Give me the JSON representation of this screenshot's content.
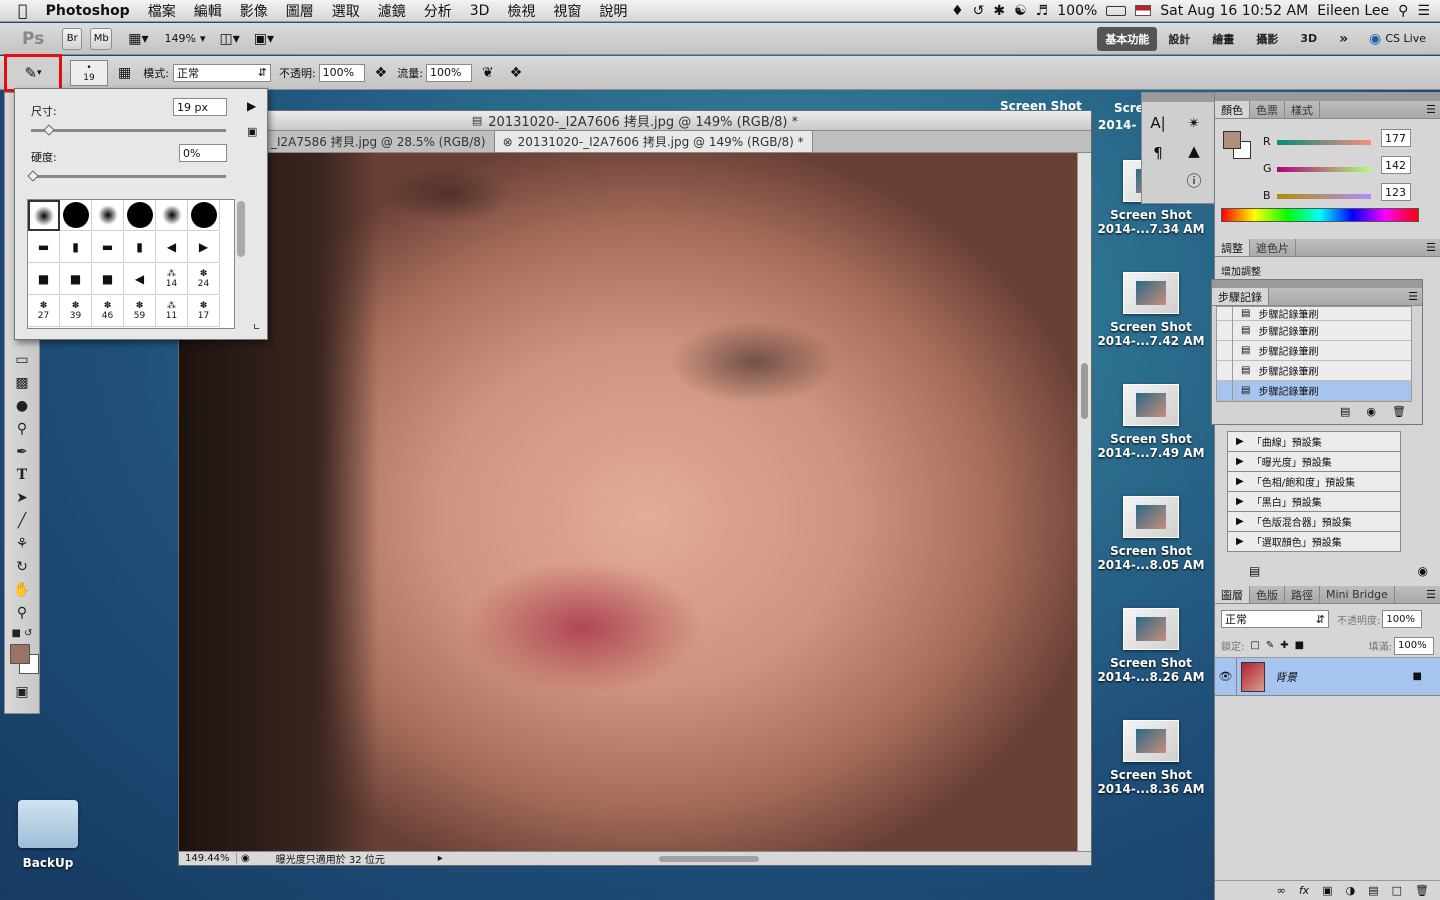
{
  "menubar": {
    "apple": "",
    "app_name": "Photoshop",
    "items": [
      "檔案",
      "編輯",
      "影像",
      "圖層",
      "選取",
      "濾鏡",
      "分析",
      "3D",
      "檢視",
      "視窗",
      "說明"
    ],
    "battery": "100%",
    "datetime": "Sat Aug 16  10:52 AM",
    "user": "Eileen Lee"
  },
  "appbar": {
    "logo": "Ps",
    "br": "Br",
    "mb": "Mb",
    "zoom": "149%",
    "workspaces": [
      "基本功能",
      "設計",
      "繪畫",
      "攝影",
      "3D"
    ],
    "more": "»",
    "cslive": "CS Live"
  },
  "optbar": {
    "brush_size": "19",
    "mode_label": "模式:",
    "mode_value": "正常",
    "opacity_label": "不透明:",
    "opacity_value": "100%",
    "flow_label": "流量:",
    "flow_value": "100%"
  },
  "brush_popup": {
    "size_label": "尺寸:",
    "size_value": "19 px",
    "hardness_label": "硬度:",
    "hardness_value": "0%",
    "row3_labels": [
      "",
      "",
      "",
      "",
      "14",
      "24"
    ],
    "row4_labels": [
      "27",
      "39",
      "46",
      "59",
      "11",
      "17"
    ]
  },
  "document": {
    "title": "20131020-_I2A7606 拷貝.jpg @ 149% (RGB/8) *",
    "tabs": [
      {
        "label": "_I2A7586 拷貝.jpg @ 28.5% (RGB/8)"
      },
      {
        "label": "20131020-_I2A7606 拷貝.jpg @ 149% (RGB/8) *"
      }
    ],
    "status_zoom": "149.44%",
    "status_text": "曝光度只適用於 32 位元"
  },
  "desktop": {
    "top_partial": "Screen Shot",
    "top_partial2": "Scre",
    "top_partial3": "2014-",
    "screenshots": [
      {
        "name": "Screen Shot",
        "date": "2014-...7.34 AM"
      },
      {
        "name": "Screen Shot",
        "date": "2014-...7.42 AM"
      },
      {
        "name": "Screen Shot",
        "date": "2014-...7.49 AM"
      },
      {
        "name": "Screen Shot",
        "date": "2014-...8.05 AM"
      },
      {
        "name": "Screen Shot",
        "date": "2014-...8.26 AM"
      },
      {
        "name": "Screen Shot",
        "date": "2014-...8.36 AM"
      }
    ],
    "folder": "BackUp"
  },
  "color_panel": {
    "tabs": [
      "顏色",
      "色票",
      "樣式"
    ],
    "r_label": "R",
    "r_value": "177",
    "g_label": "G",
    "g_value": "142",
    "b_label": "B",
    "b_value": "123",
    "foreground": "#b18e7b"
  },
  "adjust_panel": {
    "tabs": [
      "調整",
      "遮色片"
    ],
    "title": "增加調整"
  },
  "history_panel": {
    "tab": "步驟記錄",
    "items": [
      "步驟記錄筆刷",
      "步驟記錄筆刷",
      "步驟記錄筆刷",
      "步驟記錄筆刷",
      "步驟記錄筆刷"
    ]
  },
  "presets": [
    "「曲線」預設集",
    "「曝光度」預設集",
    "「色相/飽和度」預設集",
    "「黑白」預設集",
    "「色版混合器」預設集",
    "「選取顏色」預設集"
  ],
  "layers_panel": {
    "tabs": [
      "圖層",
      "色版",
      "路徑",
      "Mini Bridge"
    ],
    "blend": "正常",
    "opacity_label": "不透明度:",
    "opacity_value": "100%",
    "lock_label": "鎖定:",
    "fill_label": "填滿:",
    "fill_value": "100%",
    "layer_name": "背景"
  }
}
